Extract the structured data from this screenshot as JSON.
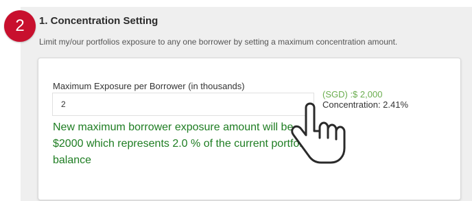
{
  "step_number": "2",
  "section": {
    "title": "1. Concentration Setting",
    "description": "Limit my/our portfolios exposure to any one borrower by setting a maximum concentration amount."
  },
  "form": {
    "label": "Maximum Exposure per Borrower (in thousands)",
    "input_value": "2",
    "currency_value": "(SGD) :$ 2,000",
    "concentration": "Concentration: 2.41%"
  },
  "annotation": "New maximum borrower exposure amount will be $2000 which represents 2.0 % of the current portfolio balance",
  "icons": {
    "pointer": "hand-pointer-icon"
  },
  "colors": {
    "badge": "#c8102e",
    "annotation": "#1e7d22",
    "currency": "#6aad4e",
    "panel": "#efefef"
  }
}
